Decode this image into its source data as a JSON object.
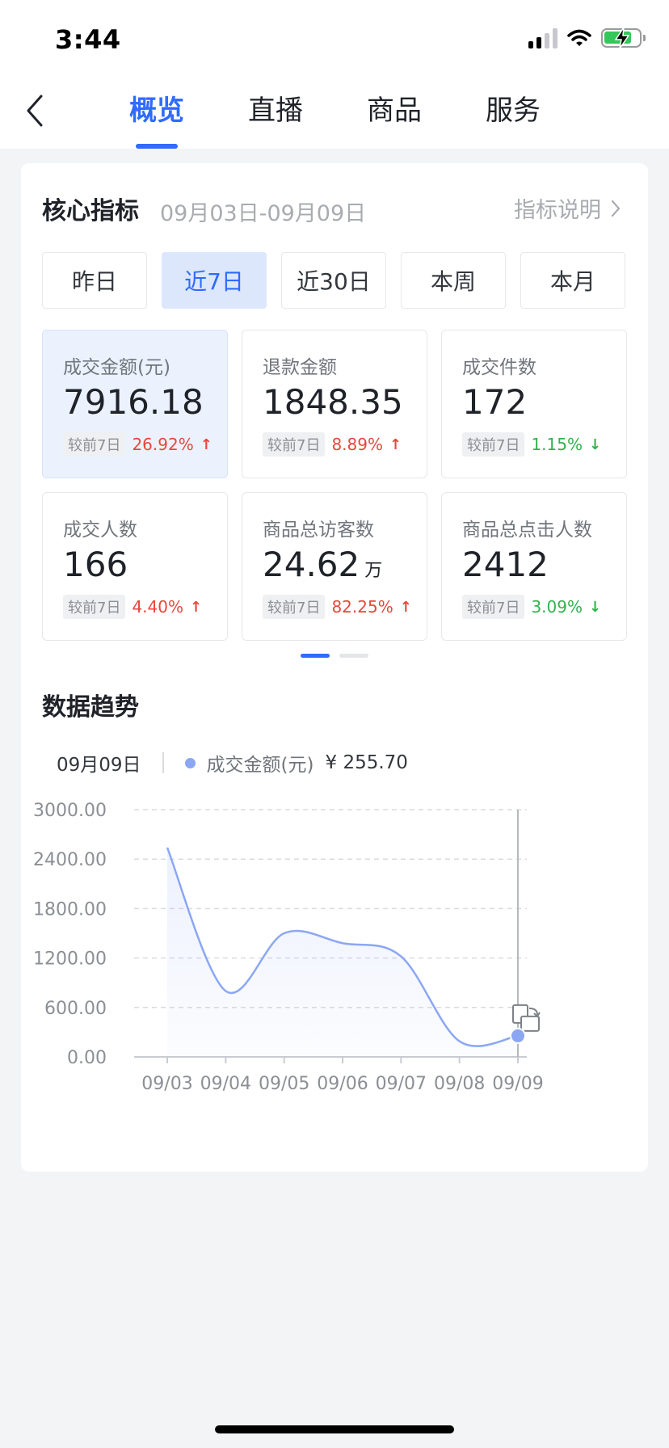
{
  "status_bar": {
    "time": "3:44"
  },
  "nav": {
    "tabs": [
      {
        "label": "概览",
        "active": true
      },
      {
        "label": "直播",
        "active": false
      },
      {
        "label": "商品",
        "active": false
      },
      {
        "label": "服务",
        "active": false
      }
    ]
  },
  "core": {
    "title": "核心指标",
    "date_range": "09月03日-09月09日",
    "explain_link": "指标说明",
    "ranges": [
      {
        "label": "昨日",
        "active": false
      },
      {
        "label": "近7日",
        "active": true
      },
      {
        "label": "近30日",
        "active": false
      },
      {
        "label": "本周",
        "active": false
      },
      {
        "label": "本月",
        "active": false
      }
    ],
    "metrics": [
      {
        "label": "成交金额(元)",
        "value": "7916.18",
        "unit": "",
        "compare_label": "较前7日",
        "change": "26.92%",
        "direction": "up",
        "active": true
      },
      {
        "label": "退款金额",
        "value": "1848.35",
        "unit": "",
        "compare_label": "较前7日",
        "change": "8.89%",
        "direction": "up",
        "active": false
      },
      {
        "label": "成交件数",
        "value": "172",
        "unit": "",
        "compare_label": "较前7日",
        "change": "1.15%",
        "direction": "down",
        "active": false
      },
      {
        "label": "成交人数",
        "value": "166",
        "unit": "",
        "compare_label": "较前7日",
        "change": "4.40%",
        "direction": "up",
        "active": false
      },
      {
        "label": "商品总访客数",
        "value": "24.62",
        "unit": "万",
        "compare_label": "较前7日",
        "change": "82.25%",
        "direction": "up",
        "active": false
      },
      {
        "label": "商品总点击人数",
        "value": "2412",
        "unit": "",
        "compare_label": "较前7日",
        "change": "3.09%",
        "direction": "down",
        "active": false
      }
    ],
    "pager": {
      "pages": 2,
      "current": 0
    }
  },
  "trend": {
    "title": "数据趋势",
    "legend": {
      "date": "09月09日",
      "series": "成交金额(元)",
      "value": "¥ 255.70"
    }
  },
  "colors": {
    "accent": "#2f6bff",
    "up": "#e8463c",
    "down": "#30b24d",
    "series": "#8ba7f3"
  },
  "chart_data": {
    "type": "line",
    "x": [
      "09/03",
      "09/04",
      "09/05",
      "09/06",
      "09/07",
      "09/08",
      "09/09"
    ],
    "series": [
      {
        "name": "成交金额(元)",
        "values": [
          2540,
          800,
          1500,
          1380,
          1220,
          190,
          255.7
        ]
      }
    ],
    "y_ticks": [
      "0.00",
      "600.00",
      "1200.00",
      "1800.00",
      "2400.00",
      "3000.00"
    ],
    "ylim": [
      0,
      3000
    ],
    "grid": true,
    "highlight_index": 6
  }
}
